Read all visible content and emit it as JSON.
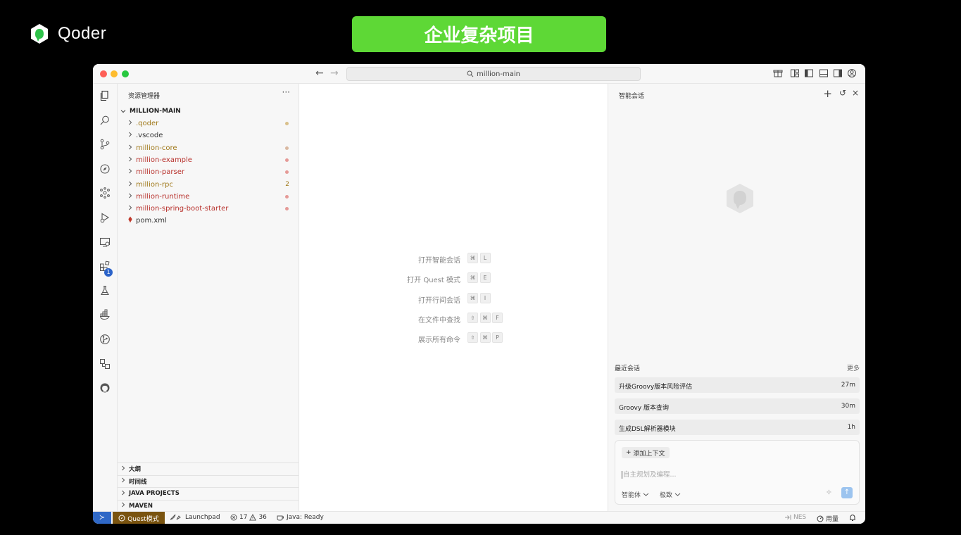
{
  "brand": {
    "name": "Qoder",
    "accent": "#5ed836"
  },
  "banner": {
    "text": "企业复杂项目"
  },
  "window": {
    "search_text": "million-main",
    "nav": {
      "back": "←",
      "forward": "→"
    }
  },
  "activity_bar": {
    "icons": [
      "explorer-icon",
      "search-icon",
      "source-control-icon",
      "compass-icon",
      "agents-icon",
      "run-debug-icon",
      "remote-explorer-icon",
      "extensions-icon",
      "testing-icon",
      "docker-icon",
      "git-graph-icon",
      "references-icon",
      "github-icon"
    ],
    "extensions_badge": "1"
  },
  "explorer": {
    "title": "资源管理器",
    "more": "···",
    "root": "MILLION-MAIN",
    "items": [
      {
        "label": ".qoder",
        "color": "#a0791b",
        "dot": "#d9c08a",
        "count": ""
      },
      {
        "label": ".vscode",
        "color": "#333333",
        "dot": "",
        "count": ""
      },
      {
        "label": "million-core",
        "color": "#a0791b",
        "dot": "#d9b8a0",
        "count": ""
      },
      {
        "label": "million-example",
        "color": "#b8322d",
        "dot": "#e59a97",
        "count": ""
      },
      {
        "label": "million-parser",
        "color": "#b8322d",
        "dot": "#e59a97",
        "count": ""
      },
      {
        "label": "million-rpc",
        "color": "#a0791b",
        "dot": "",
        "count": "2"
      },
      {
        "label": "million-runtime",
        "color": "#b8322d",
        "dot": "#e59a97",
        "count": ""
      },
      {
        "label": "million-spring-boot-starter",
        "color": "#b8322d",
        "dot": "#e59a97",
        "count": ""
      },
      {
        "label": "pom.xml",
        "color": "#333333",
        "dot": "",
        "count": "",
        "file": true
      }
    ],
    "sections": [
      "大纲",
      "时间线",
      "JAVA PROJECTS",
      "MAVEN"
    ]
  },
  "editor": {
    "commands": [
      {
        "label": "打开智能会话",
        "keys": [
          "⌘",
          "L"
        ]
      },
      {
        "label": "打开 Quest 模式",
        "keys": [
          "⌘",
          "E"
        ]
      },
      {
        "label": "打开行间会话",
        "keys": [
          "⌘",
          "I"
        ]
      },
      {
        "label": "在文件中查找",
        "keys": [
          "⇧",
          "⌘",
          "F"
        ]
      },
      {
        "label": "展示所有命令",
        "keys": [
          "⇧",
          "⌘",
          "P"
        ]
      }
    ]
  },
  "chat": {
    "title": "智能会话",
    "tools": {
      "add": "+",
      "history": "↺",
      "close": "×"
    },
    "recent_title": "最近会话",
    "more": "更多",
    "recent": [
      {
        "title": "升级Groovy版本风险评估",
        "time": "27m"
      },
      {
        "title": "Groovy 版本查询",
        "time": "30m"
      },
      {
        "title": "生成DSL解析器模块",
        "time": "1h"
      }
    ],
    "composer": {
      "add_context": "添加上下文",
      "add_context_icon": "+",
      "placeholder": "自主规划及编程...",
      "agent_select": "智能体",
      "model_select": "极致",
      "send": "↑",
      "spark": "✧"
    }
  },
  "status_bar": {
    "remote": "≻",
    "quest": "Quest模式",
    "launchpad": "Launchpad",
    "errors": "17",
    "warnings": "36",
    "java": "Java: Ready",
    "nes": "NES",
    "usage": "用量"
  }
}
